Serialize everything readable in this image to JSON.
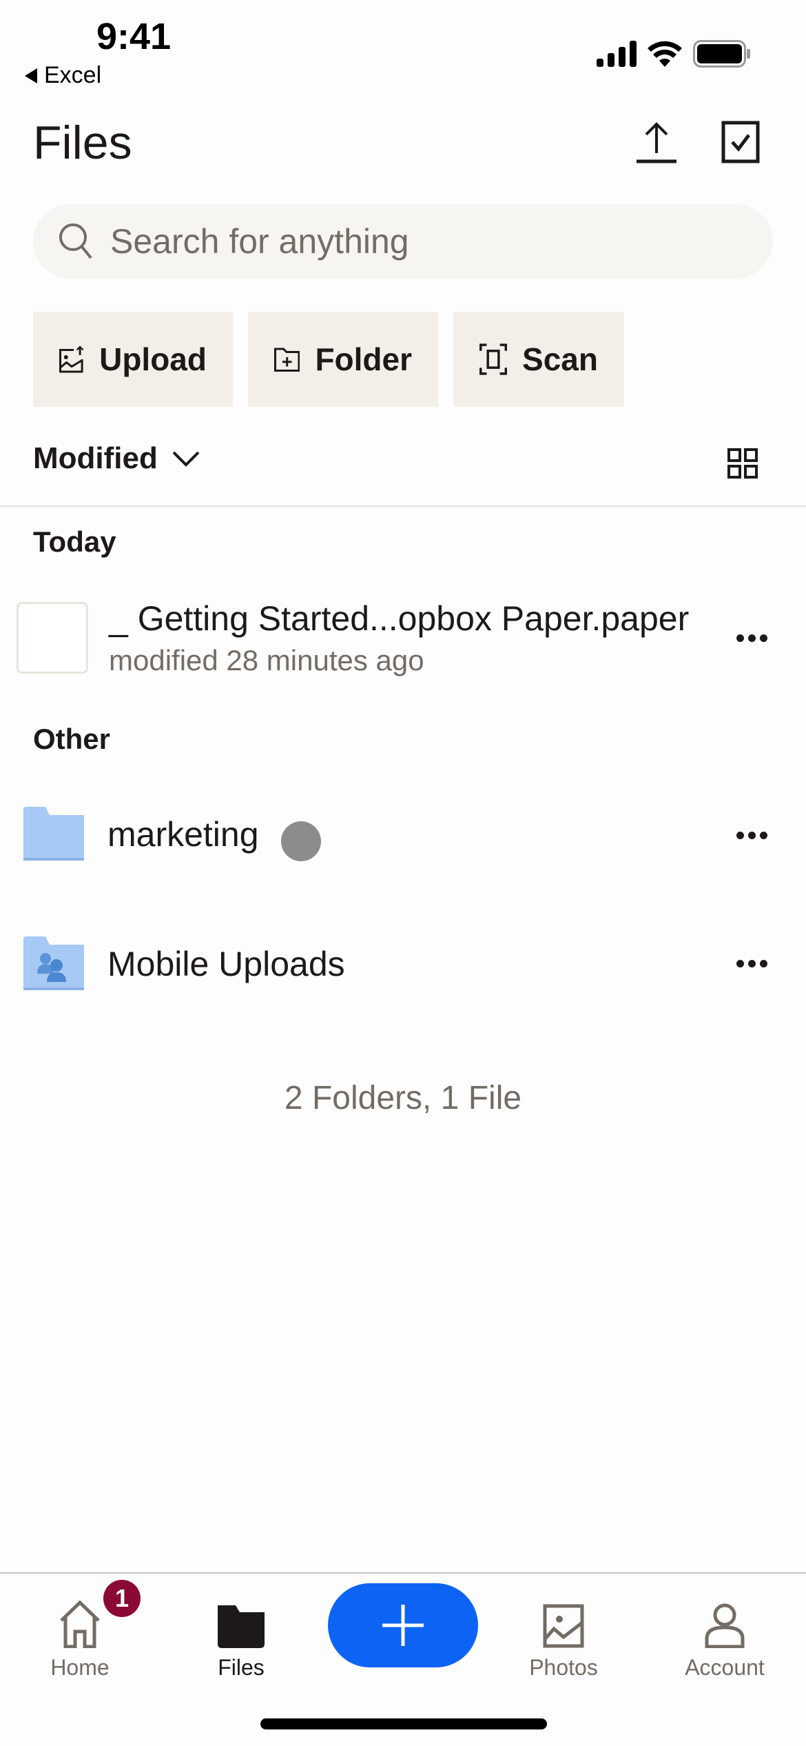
{
  "status_bar": {
    "time": "9:41",
    "back_app": "Excel"
  },
  "header": {
    "title": "Files",
    "upload_icon": "upload-arrow-icon",
    "select_icon": "checkbox-select-icon"
  },
  "search": {
    "placeholder": "Search for anything"
  },
  "actions": [
    {
      "label": "Upload",
      "icon": "upload-photo-icon"
    },
    {
      "label": "Folder",
      "icon": "new-folder-icon"
    },
    {
      "label": "Scan",
      "icon": "scan-icon"
    }
  ],
  "sort": {
    "label": "Modified",
    "view_icon": "grid-view-icon"
  },
  "sections": {
    "today": {
      "title": "Today",
      "items": [
        {
          "name": "_ Getting Started...opbox Paper.paper",
          "subtitle": "modified 28 minutes ago"
        }
      ]
    },
    "other": {
      "title": "Other",
      "items": [
        {
          "name": "marketing"
        },
        {
          "name": "Mobile Uploads"
        }
      ]
    }
  },
  "summary": "2 Folders, 1 File",
  "tabbar": {
    "items": [
      {
        "label": "Home",
        "badge": "1"
      },
      {
        "label": "Files"
      },
      {
        "label": "Photos"
      },
      {
        "label": "Account"
      }
    ],
    "active": "Files"
  },
  "colors": {
    "accent": "#0d63f3",
    "badge": "#8b0a35",
    "folder": "#a7c9f5"
  }
}
